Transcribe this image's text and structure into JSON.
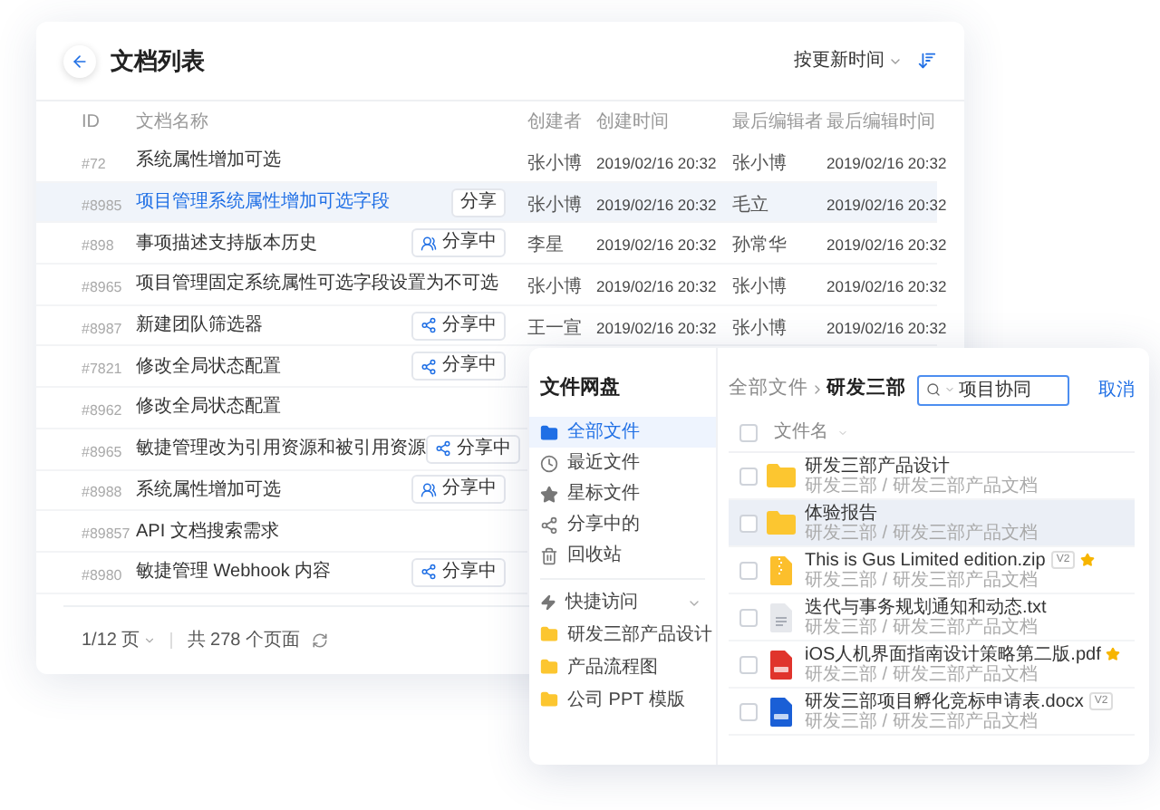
{
  "documents": {
    "title": "文档列表",
    "sort_label": "按更新时间",
    "columns": [
      "ID",
      "文档名称",
      "创建者",
      "创建时间",
      "最后编辑者",
      "最后编辑时间"
    ],
    "rows": [
      {
        "id": "#72",
        "name": "系统属性增加可选",
        "selected": false,
        "creator": "张小博",
        "created": "2019/02/16 20:32",
        "editor": "张小博",
        "edited": "2019/02/16 20:32"
      },
      {
        "id": "#8985",
        "name": "项目管理系统属性增加可选字段",
        "selected": true,
        "share": {
          "kind": "plain",
          "label": "分享"
        },
        "creator": "张小博",
        "created": "2019/02/16 20:32",
        "editor": "毛立",
        "edited": "2019/02/16 20:32"
      },
      {
        "id": "#898",
        "name": "事项描述支持版本历史",
        "selected": false,
        "share": {
          "kind": "team",
          "label": "分享中"
        },
        "creator": "李星",
        "created": "2019/02/16 20:32",
        "editor": "孙常华",
        "edited": "2019/02/16 20:32"
      },
      {
        "id": "#8965",
        "name": "项目管理固定系统属性可选字段设置为不可选",
        "selected": false,
        "creator": "张小博",
        "created": "2019/02/16 20:32",
        "editor": "张小博",
        "edited": "2019/02/16 20:32"
      },
      {
        "id": "#8987",
        "name": "新建团队筛选器",
        "selected": false,
        "share": {
          "kind": "link",
          "label": "分享中"
        },
        "creator": "王一宣",
        "created": "2019/02/16 20:32",
        "editor": "张小博",
        "edited": "2019/02/16 20:32"
      },
      {
        "id": "#7821",
        "name": "修改全局状态配置",
        "selected": false,
        "share": {
          "kind": "link",
          "label": "分享中"
        }
      },
      {
        "id": "#8962",
        "name": "修改全局状态配置",
        "selected": false
      },
      {
        "id": "#8965",
        "name": "敏捷管理改为引用资源和被引用资源",
        "selected": false,
        "share": {
          "kind": "link",
          "label": "分享中"
        }
      },
      {
        "id": "#8988",
        "name": "系统属性增加可选",
        "selected": false,
        "share": {
          "kind": "team",
          "label": "分享中"
        }
      },
      {
        "id": "#89857",
        "name": "API 文档搜索需求",
        "selected": false
      },
      {
        "id": "#8980",
        "name": "敏捷管理 Webhook 内容",
        "selected": false,
        "share": {
          "kind": "link",
          "label": "分享中"
        }
      }
    ],
    "footer": {
      "page": "1/12 页",
      "total": "共 278 个页面"
    }
  },
  "drive": {
    "title": "文件网盘",
    "nav": [
      {
        "label": "全部文件",
        "selected": true
      },
      {
        "label": "最近文件",
        "selected": false
      },
      {
        "label": "星标文件",
        "selected": false
      },
      {
        "label": "分享中的",
        "selected": false
      },
      {
        "label": "回收站",
        "selected": false
      }
    ],
    "quick_access": {
      "label": "快捷访问",
      "expanded": true,
      "items": [
        "研发三部产品设计",
        "产品流程图",
        "公司 PPT 模版"
      ]
    },
    "breadcrumb": [
      "全部文件",
      "研发三部"
    ],
    "search": {
      "value": "项目协同"
    },
    "cancel": "取消",
    "list_header": {
      "label": "文件名",
      "checked": false
    },
    "files": [
      {
        "name": "研发三部产品设计",
        "path": "研发三部 / 研发三部产品文档",
        "kind": "folder",
        "checked": false,
        "selected": false
      },
      {
        "name": "体验报告",
        "path": "研发三部 / 研发三部产品文档",
        "kind": "folder",
        "checked": false,
        "selected": true
      },
      {
        "name": "This is Gus Limited edition.zip",
        "path": "研发三部 / 研发三部产品文档",
        "kind": "zip",
        "version": "V2",
        "starred": true,
        "checked": false,
        "selected": false
      },
      {
        "name": "迭代与事务规划通知和动态.txt",
        "path": "研发三部 / 研发三部产品文档",
        "kind": "txt",
        "checked": false,
        "selected": false
      },
      {
        "name": "iOS人机界面指南设计策略第二版.pdf",
        "path": "研发三部 / 研发三部产品文档",
        "kind": "pdf",
        "starred": true,
        "checked": false,
        "selected": false
      },
      {
        "name": "研发三部项目孵化竞标申请表.docx",
        "path": "研发三部 / 研发三部产品文档",
        "kind": "doc",
        "version": "V2",
        "checked": false,
        "selected": false
      }
    ]
  }
}
